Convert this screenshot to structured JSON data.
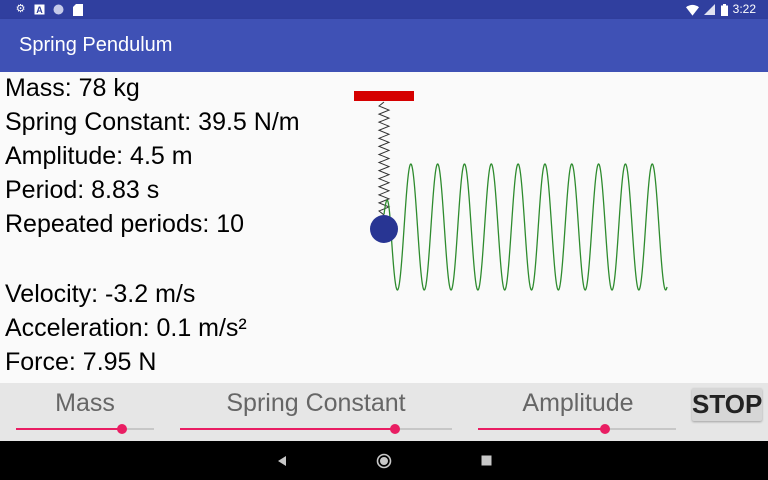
{
  "status_bar": {
    "icons": [
      "gear-icon",
      "a-box-icon",
      "circle-icon",
      "sd-card-icon"
    ],
    "right_icons": [
      "wifi-icon",
      "signal-icon",
      "battery-icon"
    ],
    "time": "3:22"
  },
  "app_bar": {
    "title": "Spring Pendulum"
  },
  "params": {
    "mass": "Mass: 78 kg",
    "spring_constant": "Spring Constant: 39.5 N/m",
    "amplitude": "Amplitude: 4.5 m",
    "period": "Period: 8.83 s",
    "repeated_periods": "Repeated periods: 10"
  },
  "dynamics": {
    "velocity": "Velocity: -3.2 m/s",
    "acceleration": "Acceleration: 0.1 m/s²",
    "force": "Force: 7.95 N"
  },
  "simulation": {
    "colors": {
      "anchor": "#d50000",
      "spring": "#333333",
      "bob": "#283593",
      "trace": "#2e8b2e"
    },
    "trace_cycles": 10
  },
  "controls": {
    "sliders": [
      {
        "label": "Mass",
        "fraction": 0.77
      },
      {
        "label": "Spring Constant",
        "fraction": 0.79
      },
      {
        "label": "Amplitude",
        "fraction": 0.64
      }
    ],
    "stop_label": "STOP",
    "accent_color": "#e91e63"
  },
  "nav_bar": {
    "buttons": [
      "back-icon",
      "home-icon",
      "recents-icon"
    ]
  }
}
